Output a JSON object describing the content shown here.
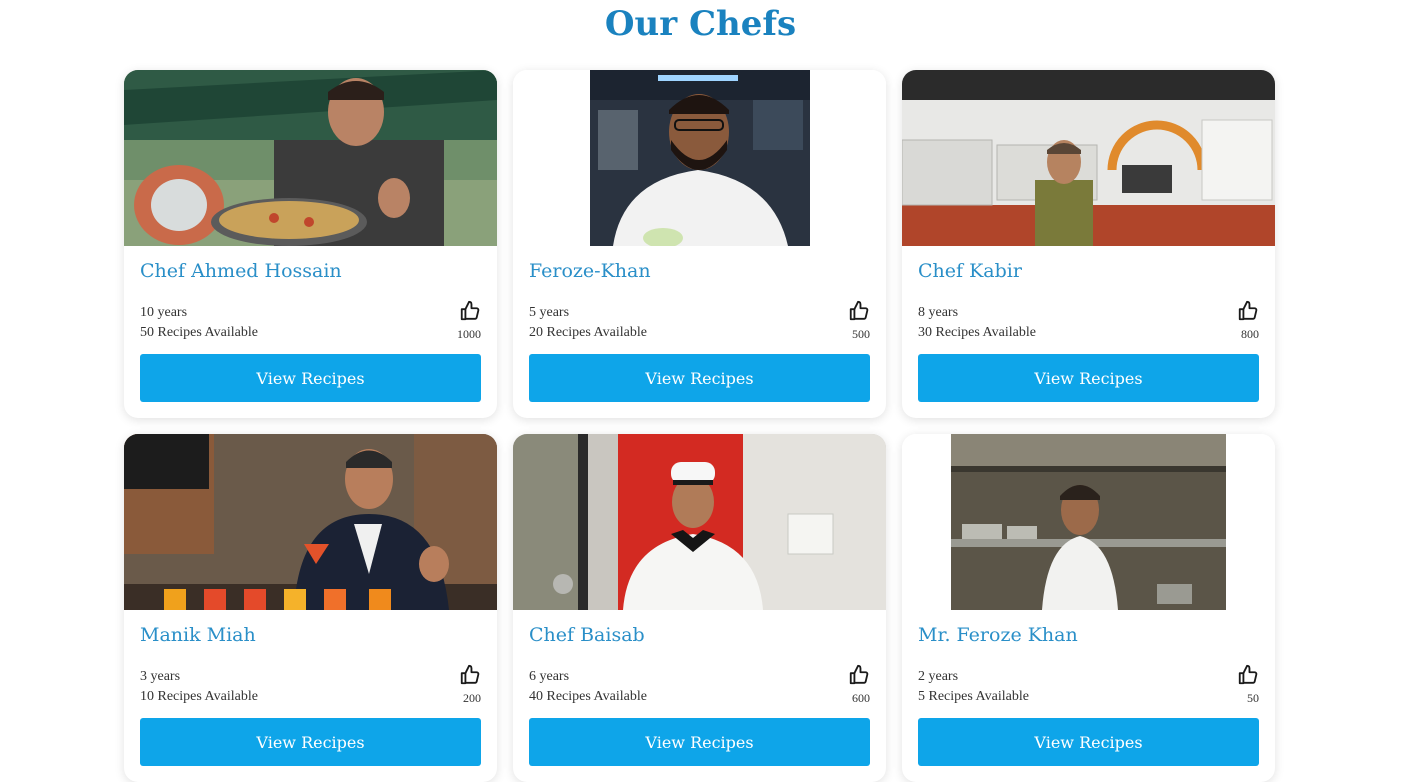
{
  "page": {
    "title": "Our Chefs"
  },
  "colors": {
    "accent": "#0ea5e9",
    "title": "#1a82bf",
    "name": "#2a8fc8"
  },
  "chefs": [
    {
      "name": "Chef Ahmed Hossain",
      "experience": "10 years",
      "recipes": "50 Recipes Available",
      "likes": "1000",
      "button": "View Recipes",
      "photo": "chef-on-boat-with-paella"
    },
    {
      "name": "Feroze-Khan",
      "experience": "5 years",
      "recipes": "20 Recipes Available",
      "likes": "500",
      "button": "View Recipes",
      "photo": "chef-in-white-coat-in-kitchen"
    },
    {
      "name": "Chef Kabir",
      "experience": "8 years",
      "recipes": "30 Recipes Available",
      "likes": "800",
      "button": "View Recipes",
      "photo": "chef-in-tv-studio-kitchen"
    },
    {
      "name": "Manik Miah",
      "experience": "3 years",
      "recipes": "10 Recipes Available",
      "likes": "200",
      "button": "View Recipes",
      "photo": "chef-with-cocktails"
    },
    {
      "name": "Chef Baisab",
      "experience": "6 years",
      "recipes": "40 Recipes Available",
      "likes": "600",
      "button": "View Recipes",
      "photo": "chef-in-hat-with-trophies"
    },
    {
      "name": "Mr. Feroze Khan",
      "experience": "2 years",
      "recipes": "5 Recipes Available",
      "likes": "50",
      "button": "View Recipes",
      "photo": "chef-in-commercial-kitchen"
    }
  ]
}
